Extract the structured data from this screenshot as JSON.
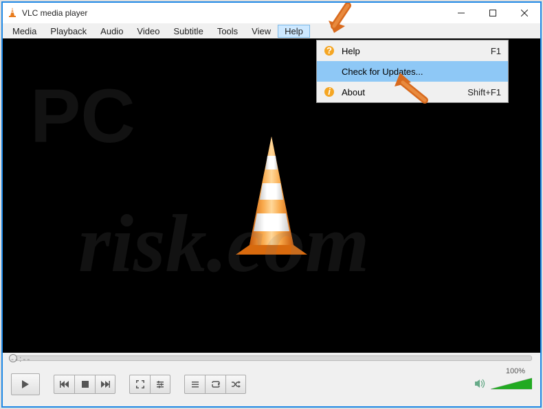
{
  "title": "VLC media player",
  "menubar": [
    "Media",
    "Playback",
    "Audio",
    "Video",
    "Subtitle",
    "Tools",
    "View",
    "Help"
  ],
  "selected_menu_index": 7,
  "dropdown": [
    {
      "label": "Help",
      "shortcut": "F1",
      "icon": "help",
      "selected": false
    },
    {
      "label": "Check for Updates...",
      "shortcut": "",
      "icon": "",
      "selected": true
    },
    {
      "label": "About",
      "shortcut": "Shift+F1",
      "icon": "info",
      "selected": false
    }
  ],
  "timecode": "--:--",
  "volume_percent": "100%",
  "watermark_line1": "PC",
  "watermark_line2": "risk.com"
}
